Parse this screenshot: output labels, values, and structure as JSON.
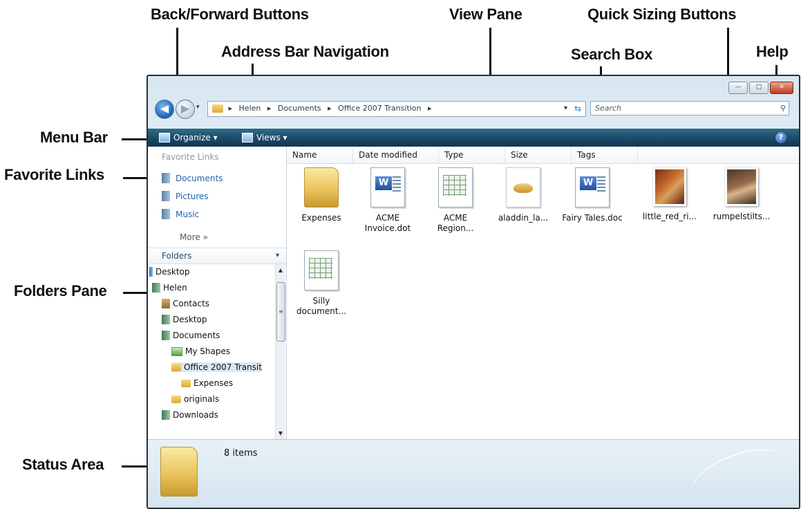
{
  "callouts": {
    "back_forward": "Back/Forward Buttons",
    "address_bar": "Address Bar Navigation",
    "view_pane": "View Pane",
    "quick_sizing": "Quick Sizing Buttons",
    "search_box": "Search Box",
    "help": "Help",
    "menu_bar": "Menu Bar",
    "favorite_links": "Favorite Links",
    "folders_pane": "Folders Pane",
    "status_area": "Status Area"
  },
  "window": {
    "min_glyph": "—",
    "max_glyph": "□",
    "close_glyph": "✕"
  },
  "nav": {
    "back_glyph": "◀",
    "forward_glyph": "▶",
    "history_glyph": "▾"
  },
  "address": {
    "crumbs": [
      "Helen",
      "Documents",
      "Office 2007 Transition"
    ],
    "separator": "▸",
    "dropdown_glyph": "▾",
    "refresh_glyph": "⇆"
  },
  "search": {
    "placeholder": "Search",
    "icon": "⚲"
  },
  "menubar": {
    "organize": "Organize ▾",
    "views": "Views ▾",
    "help_glyph": "?"
  },
  "favorites": {
    "header": "Favorite Links",
    "items": [
      "Documents",
      "Pictures",
      "Music"
    ],
    "more": "More »"
  },
  "folders": {
    "header": "Folders",
    "chevron": "▾",
    "tree": [
      "Desktop",
      "Helen",
      "Contacts",
      "Desktop",
      "Documents",
      "My Shapes",
      "Office 2007 Transit",
      "Expenses",
      "originals",
      "Downloads"
    ]
  },
  "columns": [
    "Name",
    "Date modified",
    "Type",
    "Size",
    "Tags"
  ],
  "files": [
    {
      "name": "Expenses",
      "icon": "folder-icon"
    },
    {
      "name": "ACME Invoice.dot",
      "icon": "word-template-icon"
    },
    {
      "name": "ACME Region...",
      "icon": "excel-icon"
    },
    {
      "name": "aladdin_la...",
      "icon": "lamp-image-icon"
    },
    {
      "name": "Fairy Tales.doc",
      "icon": "word-doc-icon"
    },
    {
      "name": "little_red_ri...",
      "icon": "painting-icon"
    },
    {
      "name": "rumpelstilts...",
      "icon": "painting-icon"
    },
    {
      "name": "Silly document...",
      "icon": "excel-icon"
    }
  ],
  "status": {
    "count": "8 items"
  }
}
